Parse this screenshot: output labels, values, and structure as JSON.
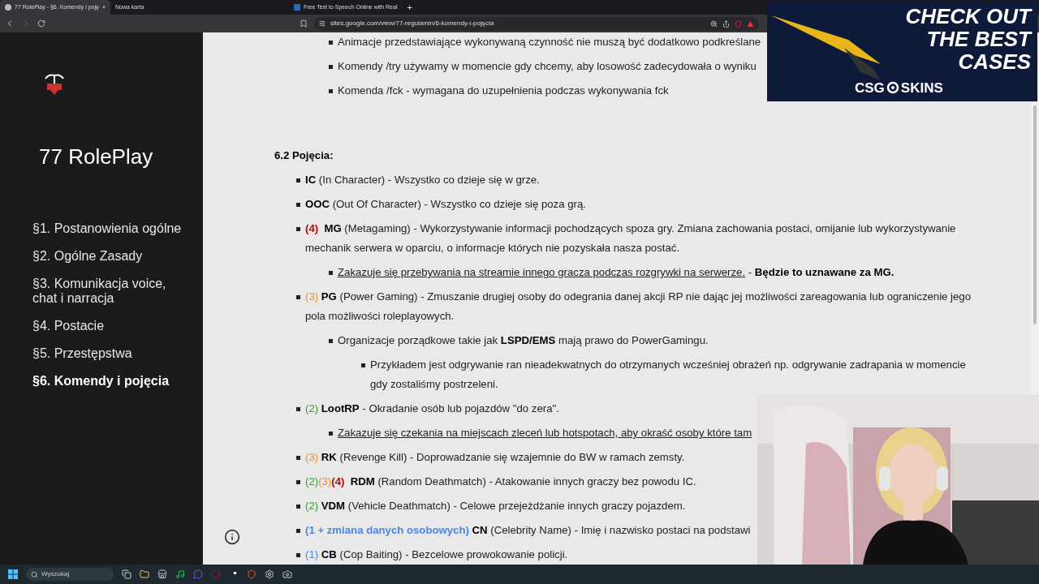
{
  "browser": {
    "tabs": [
      {
        "label": "77 RolePlay - §6. Komendy i poję",
        "selected": true,
        "close": "×"
      },
      {
        "label": "Nowa karta",
        "selected": false
      },
      {
        "label": "Free Text to Speech Online with Real",
        "selected": false
      }
    ],
    "new_tab": "+",
    "address": "sites.google.com/view/77-regulamin/6-komendy-i-pojęcia"
  },
  "sidebar": {
    "title": "77 RolePlay",
    "items": [
      {
        "label": "§1. Postanowienia ogólne",
        "selected": false
      },
      {
        "label": "§2. Ogólne Zasady",
        "selected": false
      },
      {
        "label": "§3. Komunikacja voice, chat i narracja",
        "selected": false
      },
      {
        "label": "§4. Postacie",
        "selected": false
      },
      {
        "label": "§5. Przestępstwa",
        "selected": false
      },
      {
        "label": "§6. Komendy i pojęcia",
        "selected": true
      }
    ]
  },
  "content": {
    "top_items": [
      [
        {
          "kind": "text",
          "text": "Animacje przedstawiające wykonywaną czynność nie muszą być dodatkowo podkreślane"
        }
      ],
      [
        {
          "kind": "text",
          "text": "Komendy /try używamy w momencie gdy chcemy, aby losowość zadecydowała o wyniku"
        }
      ],
      [
        {
          "kind": "text",
          "text": "Komenda /fck - wymagana do uzupełnienia podczas wykonywania fck"
        }
      ]
    ],
    "heading": "6.2 Pojęcia:",
    "items": [
      {
        "segments": [
          {
            "kind": "term",
            "text": "IC"
          },
          {
            "kind": "text",
            "text": " (In Character) - Wszystko co dzieje się w grze."
          }
        ]
      },
      {
        "segments": [
          {
            "kind": "term",
            "text": "OOC"
          },
          {
            "kind": "text",
            "text": " (Out Of Character) - Wszystko co dzieje się poza grą."
          }
        ]
      },
      {
        "segments": [
          {
            "kind": "code",
            "text": "(4)",
            "color": "#cc0000",
            "bold": true
          },
          {
            "kind": "term",
            "text": "  MG"
          },
          {
            "kind": "text",
            "text": " (Metagaming) - Wykorzystywanie informacji pochodzących spoza gry. Zmiana zachowania postaci, omijanie lub wykorzystywanie mechanik serwera w oparciu, o informacje których nie pozyskała nasza postać."
          }
        ],
        "children": [
          {
            "segments": [
              {
                "kind": "underline",
                "text": "Zakazuje się przebywania na streamie innego gracza podczas rozgrywki na serwerze."
              },
              {
                "kind": "text",
                "text": " - "
              },
              {
                "kind": "term",
                "text": "Będzie to uznawane za MG."
              }
            ]
          }
        ]
      },
      {
        "segments": [
          {
            "kind": "code",
            "text": "(3)",
            "color": "#e69138",
            "bold": false
          },
          {
            "kind": "term",
            "text": " PG"
          },
          {
            "kind": "text",
            "text": " (Power Gaming) - Zmuszanie drugiej osoby do odegrania danej akcji RP nie dając jej możliwości zareagowania lub ograniczenie jego pola możliwości roleplayowych."
          }
        ],
        "children": [
          {
            "segments": [
              {
                "kind": "text",
                "text": "Organizacje porządkowe takie jak "
              },
              {
                "kind": "term",
                "text": "LSPD/EMS"
              },
              {
                "kind": "text",
                "text": " mają prawo do PowerGamingu."
              }
            ],
            "children": [
              {
                "segments": [
                  {
                    "kind": "text",
                    "text": "Przykładem jest odgrywanie ran nieadekwatnych do otrzymanych wcześniej obrażeń np. odgrywanie zadrapania w momencie gdy zostaliśmy postrzeleni."
                  }
                ]
              }
            ]
          }
        ]
      },
      {
        "segments": [
          {
            "kind": "code",
            "text": "(2)",
            "color": "#38a035",
            "bold": false
          },
          {
            "kind": "term",
            "text": " LootRP"
          },
          {
            "kind": "text",
            "text": " - Okradanie osób lub pojazdów \"do zera\"."
          }
        ],
        "children": [
          {
            "segments": [
              {
                "kind": "underline",
                "text": "Zakazuje się czekania na miejscach zleceń lub hotspotach, aby okraść osoby które tam"
              }
            ]
          }
        ]
      },
      {
        "segments": [
          {
            "kind": "code",
            "text": "(3)",
            "color": "#e69138",
            "bold": false
          },
          {
            "kind": "term",
            "text": " RK"
          },
          {
            "kind": "text",
            "text": " (Revenge Kill) - Doprowadzanie się wzajemnie do BW w ramach zemsty."
          }
        ]
      },
      {
        "segments": [
          {
            "kind": "code",
            "text": "(2)",
            "color": "#38a035",
            "bold": false
          },
          {
            "kind": "code",
            "text": "(3)",
            "color": "#e69138",
            "bold": false
          },
          {
            "kind": "code",
            "text": "(4)",
            "color": "#cc0000",
            "bold": true
          },
          {
            "kind": "term",
            "text": "  RDM"
          },
          {
            "kind": "text",
            "text": " (Random Deathmatch) - Atakowanie innych graczy bez powodu IC."
          }
        ]
      },
      {
        "segments": [
          {
            "kind": "code",
            "text": "(2)",
            "color": "#38a035",
            "bold": false
          },
          {
            "kind": "term",
            "text": " VDM"
          },
          {
            "kind": "text",
            "text": " (Vehicle Deathmatch) - Celowe przejeżdżanie innych graczy pojazdem."
          }
        ]
      },
      {
        "segments": [
          {
            "kind": "code",
            "text": "(1 + zmiana danych osobowych)",
            "color": "#4a86e8",
            "bold": true
          },
          {
            "kind": "term",
            "text": " CN"
          },
          {
            "kind": "text",
            "text": " (Celebrity Name) - Imię i nazwisko postaci na podstawi"
          }
        ]
      },
      {
        "segments": [
          {
            "kind": "code",
            "text": "(1)",
            "color": "#4a86e8",
            "bold": false
          },
          {
            "kind": "term",
            "text": " CB"
          },
          {
            "kind": "text",
            "text": " (Cop Baiting) - Bezcelowe prowokowanie policji."
          }
        ]
      }
    ]
  },
  "ad": {
    "headline": [
      "CHECK OUT",
      "THE BEST",
      "CASES"
    ],
    "brand_left": "CSG",
    "brand_right": "SKINS"
  },
  "taskbar": {
    "search_placeholder": "Wyszukaj"
  }
}
